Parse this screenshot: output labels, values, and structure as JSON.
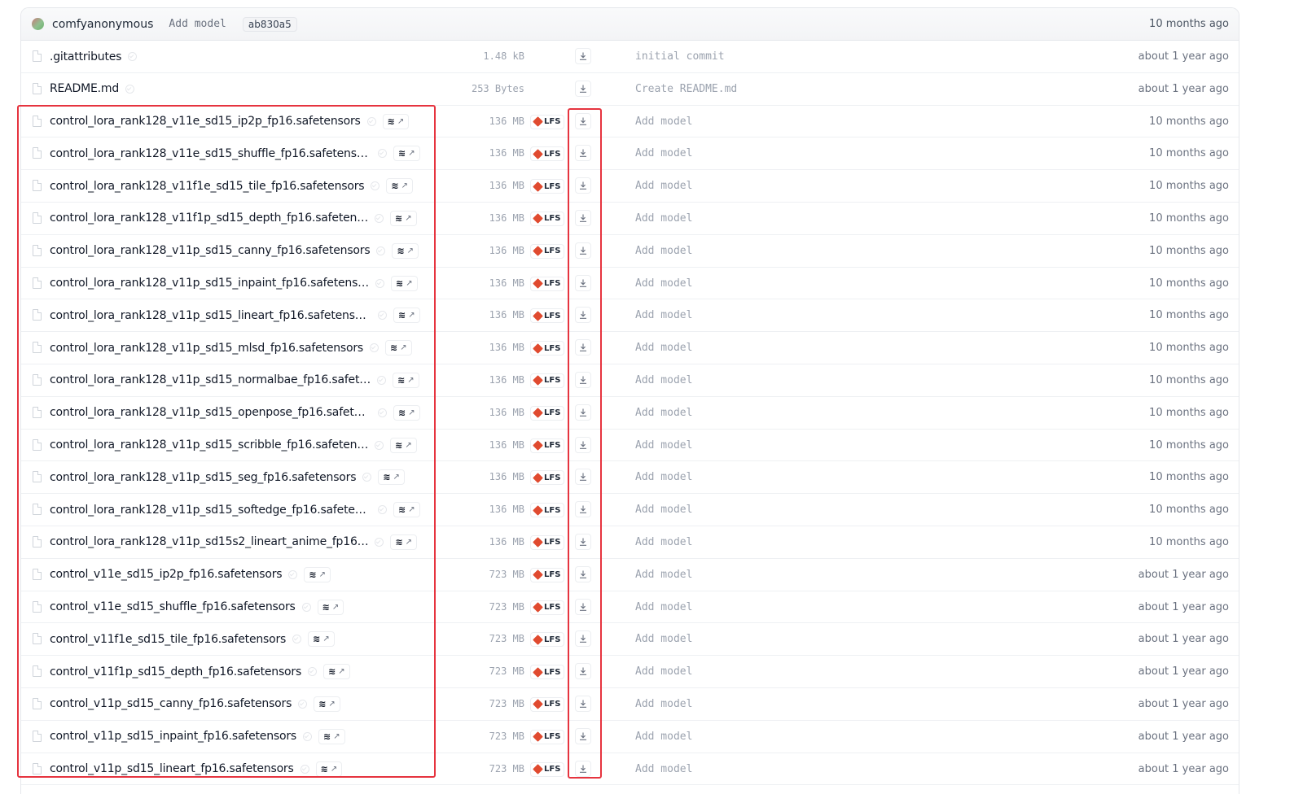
{
  "header": {
    "author": "comfyanonymous",
    "commit_message": "Add model",
    "commit_hash": "ab830a5",
    "time": "10 months ago"
  },
  "icons": {
    "avatar": "user-avatar",
    "file": "file-icon",
    "safe": "safe-check-icon",
    "viewer": "layers-icon",
    "viewer_arrow": "external-arrow-icon",
    "lfs": "lfs-icon",
    "download": "download-icon"
  },
  "colors": {
    "highlight": "#e6343f",
    "lfs": "#e04a2f"
  },
  "files": [
    {
      "name": ".gitattributes",
      "viewer": false,
      "lfs": null,
      "size": "1.48 kB",
      "message": "initial commit",
      "time": "about 1 year ago"
    },
    {
      "name": "README.md",
      "viewer": false,
      "lfs": null,
      "size": "253 Bytes",
      "message": "Create README.md",
      "time": "about 1 year ago"
    },
    {
      "name": "control_lora_rank128_v11e_sd15_ip2p_fp16.safetensors",
      "viewer": true,
      "lfs": "LFS",
      "size": "136 MB",
      "message": "Add model",
      "time": "10 months ago"
    },
    {
      "name": "control_lora_rank128_v11e_sd15_shuffle_fp16.safetensors",
      "viewer": true,
      "lfs": "LFS",
      "size": "136 MB",
      "message": "Add model",
      "time": "10 months ago"
    },
    {
      "name": "control_lora_rank128_v11f1e_sd15_tile_fp16.safetensors",
      "viewer": true,
      "lfs": "LFS",
      "size": "136 MB",
      "message": "Add model",
      "time": "10 months ago"
    },
    {
      "name": "control_lora_rank128_v11f1p_sd15_depth_fp16.safeten…",
      "viewer": true,
      "lfs": "LFS",
      "size": "136 MB",
      "message": "Add model",
      "time": "10 months ago"
    },
    {
      "name": "control_lora_rank128_v11p_sd15_canny_fp16.safetensors",
      "viewer": true,
      "lfs": "LFS",
      "size": "136 MB",
      "message": "Add model",
      "time": "10 months ago"
    },
    {
      "name": "control_lora_rank128_v11p_sd15_inpaint_fp16.safetens…",
      "viewer": true,
      "lfs": "LFS",
      "size": "136 MB",
      "message": "Add model",
      "time": "10 months ago"
    },
    {
      "name": "control_lora_rank128_v11p_sd15_lineart_fp16.safetensors",
      "viewer": true,
      "lfs": "LFS",
      "size": "136 MB",
      "message": "Add model",
      "time": "10 months ago"
    },
    {
      "name": "control_lora_rank128_v11p_sd15_mlsd_fp16.safetensors",
      "viewer": true,
      "lfs": "LFS",
      "size": "136 MB",
      "message": "Add model",
      "time": "10 months ago"
    },
    {
      "name": "control_lora_rank128_v11p_sd15_normalbae_fp16.safet…",
      "viewer": true,
      "lfs": "LFS",
      "size": "136 MB",
      "message": "Add model",
      "time": "10 months ago"
    },
    {
      "name": "control_lora_rank128_v11p_sd15_openpose_fp16.safete…",
      "viewer": true,
      "lfs": "LFS",
      "size": "136 MB",
      "message": "Add model",
      "time": "10 months ago"
    },
    {
      "name": "control_lora_rank128_v11p_sd15_scribble_fp16.safeten…",
      "viewer": true,
      "lfs": "LFS",
      "size": "136 MB",
      "message": "Add model",
      "time": "10 months ago"
    },
    {
      "name": "control_lora_rank128_v11p_sd15_seg_fp16.safetensors",
      "viewer": true,
      "lfs": "LFS",
      "size": "136 MB",
      "message": "Add model",
      "time": "10 months ago"
    },
    {
      "name": "control_lora_rank128_v11p_sd15_softedge_fp16.safeten…",
      "viewer": true,
      "lfs": "LFS",
      "size": "136 MB",
      "message": "Add model",
      "time": "10 months ago"
    },
    {
      "name": "control_lora_rank128_v11p_sd15s2_lineart_anime_fp16…",
      "viewer": true,
      "lfs": "LFS",
      "size": "136 MB",
      "message": "Add model",
      "time": "10 months ago"
    },
    {
      "name": "control_v11e_sd15_ip2p_fp16.safetensors",
      "viewer": true,
      "lfs": "LFS",
      "size": "723 MB",
      "message": "Add model",
      "time": "about 1 year ago"
    },
    {
      "name": "control_v11e_sd15_shuffle_fp16.safetensors",
      "viewer": true,
      "lfs": "LFS",
      "size": "723 MB",
      "message": "Add model",
      "time": "about 1 year ago"
    },
    {
      "name": "control_v11f1e_sd15_tile_fp16.safetensors",
      "viewer": true,
      "lfs": "LFS",
      "size": "723 MB",
      "message": "Add model",
      "time": "about 1 year ago"
    },
    {
      "name": "control_v11f1p_sd15_depth_fp16.safetensors",
      "viewer": true,
      "lfs": "LFS",
      "size": "723 MB",
      "message": "Add model",
      "time": "about 1 year ago"
    },
    {
      "name": "control_v11p_sd15_canny_fp16.safetensors",
      "viewer": true,
      "lfs": "LFS",
      "size": "723 MB",
      "message": "Add model",
      "time": "about 1 year ago"
    },
    {
      "name": "control_v11p_sd15_inpaint_fp16.safetensors",
      "viewer": true,
      "lfs": "LFS",
      "size": "723 MB",
      "message": "Add model",
      "time": "about 1 year ago"
    },
    {
      "name": "control_v11p_sd15_lineart_fp16.safetensors",
      "viewer": true,
      "lfs": "LFS",
      "size": "723 MB",
      "message": "Add model",
      "time": "about 1 year ago"
    }
  ]
}
